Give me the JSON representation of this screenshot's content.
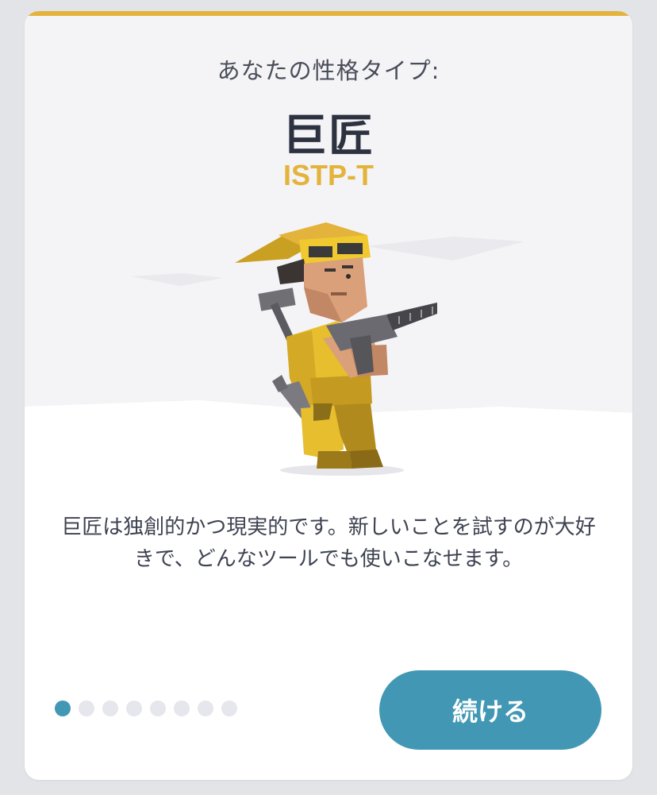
{
  "header": {
    "subtitle": "あなたの性格タイプ:",
    "type_name": "巨匠",
    "type_code": "ISTP-T"
  },
  "illustration": {
    "icon": "virtuoso-craftsman-illustration"
  },
  "description": "巨匠は独創的かつ現実的です。新しいことを試すのが大好きで、どんなツールでも使いこなせます。",
  "pager": {
    "total": 8,
    "current": 1
  },
  "actions": {
    "continue_label": "続ける"
  },
  "colors": {
    "accent_gold": "#e3b33c",
    "button_blue": "#4298b4",
    "dot_inactive": "#e6e7ec",
    "text_dark": "#2d3240"
  }
}
